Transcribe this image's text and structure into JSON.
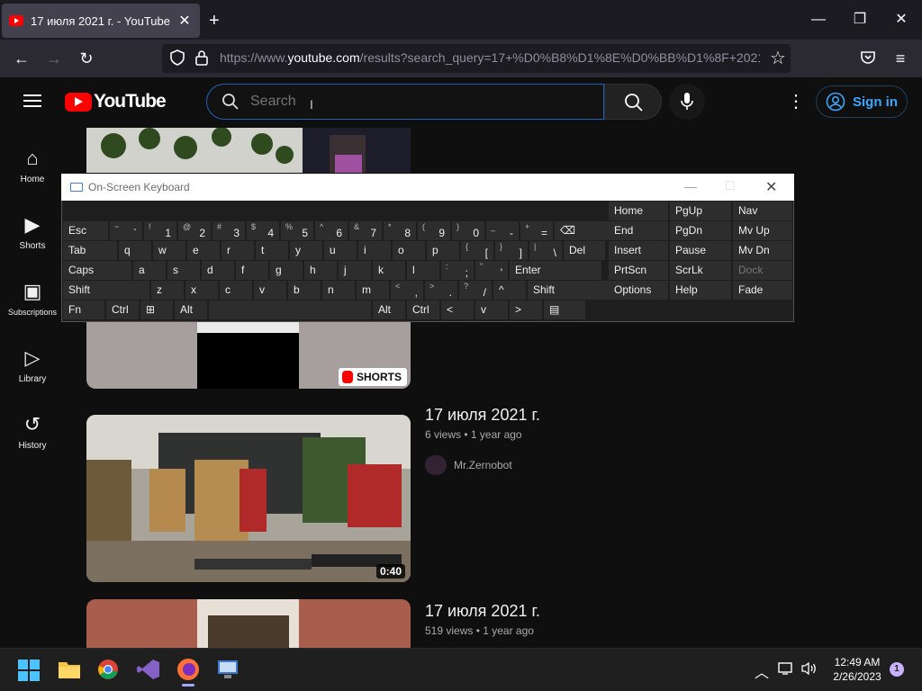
{
  "browser": {
    "tab_title": "17 июля 2021 г. - YouTube",
    "new_tab": "+",
    "url_prefix": "https://www.",
    "url_domain": "youtube.com",
    "url_rest": "/results?search_query=17+%D0%B8%D1%8E%D0%BB%D1%8F+2021+"
  },
  "youtube": {
    "logo_text": "YouTube",
    "search_placeholder": "Search",
    "signin": "Sign in",
    "sidebar": [
      {
        "label": "Home",
        "icon": "home-icon"
      },
      {
        "label": "Shorts",
        "icon": "shorts-icon"
      },
      {
        "label": "Subscriptions",
        "icon": "subscriptions-icon"
      },
      {
        "label": "Library",
        "icon": "library-icon"
      },
      {
        "label": "History",
        "icon": "history-icon"
      }
    ],
    "shorts_badge": "SHORTS",
    "videos": [
      {
        "title": "17 июля 2021 г.",
        "views": "6 views",
        "age": "1 year ago",
        "channel": "Mr.Zernobot",
        "duration": "0:40"
      },
      {
        "title": "17 июля 2021 г.",
        "views": "519 views",
        "age": "1 year ago"
      }
    ]
  },
  "osk": {
    "title": "On-Screen Keyboard",
    "rows": [
      [
        {
          "l": "Esc"
        },
        {
          "l": "`",
          "s": "~"
        },
        {
          "l": "1",
          "s": "!"
        },
        {
          "l": "2",
          "s": "@"
        },
        {
          "l": "3",
          "s": "#"
        },
        {
          "l": "4",
          "s": "$"
        },
        {
          "l": "5",
          "s": "%"
        },
        {
          "l": "6",
          "s": "^"
        },
        {
          "l": "7",
          "s": "&"
        },
        {
          "l": "8",
          "s": "*"
        },
        {
          "l": "9",
          "s": "("
        },
        {
          "l": "0",
          "s": ")"
        },
        {
          "l": "-",
          "s": "_"
        },
        {
          "l": "=",
          "s": "+"
        },
        {
          "l": "⌫"
        }
      ],
      [
        {
          "l": "Tab"
        },
        {
          "l": "q"
        },
        {
          "l": "w"
        },
        {
          "l": "e"
        },
        {
          "l": "r"
        },
        {
          "l": "t"
        },
        {
          "l": "y"
        },
        {
          "l": "u"
        },
        {
          "l": "i"
        },
        {
          "l": "o"
        },
        {
          "l": "p"
        },
        {
          "l": "[",
          "s": "{"
        },
        {
          "l": "]",
          "s": "}"
        },
        {
          "l": "\\",
          "s": "|"
        },
        {
          "l": "Del"
        }
      ],
      [
        {
          "l": "Caps"
        },
        {
          "l": "a"
        },
        {
          "l": "s"
        },
        {
          "l": "d"
        },
        {
          "l": "f"
        },
        {
          "l": "g"
        },
        {
          "l": "h"
        },
        {
          "l": "j"
        },
        {
          "l": "k"
        },
        {
          "l": "l"
        },
        {
          "l": ";",
          "s": ":"
        },
        {
          "l": "'",
          "s": "\""
        },
        {
          "l": "Enter"
        }
      ],
      [
        {
          "l": "Shift"
        },
        {
          "l": "z"
        },
        {
          "l": "x"
        },
        {
          "l": "c"
        },
        {
          "l": "v"
        },
        {
          "l": "b"
        },
        {
          "l": "n"
        },
        {
          "l": "m"
        },
        {
          "l": ",",
          "s": "<"
        },
        {
          "l": ".",
          "s": ">"
        },
        {
          "l": "/",
          "s": "?"
        },
        {
          "l": "^"
        },
        {
          "l": "Shift"
        }
      ],
      [
        {
          "l": "Fn"
        },
        {
          "l": "Ctrl"
        },
        {
          "l": "⊞"
        },
        {
          "l": "Alt"
        },
        {
          "l": ""
        },
        {
          "l": "Alt"
        },
        {
          "l": "Ctrl"
        },
        {
          "l": "<"
        },
        {
          "l": "v"
        },
        {
          "l": ">"
        },
        {
          "l": "▤"
        }
      ]
    ],
    "nav": [
      [
        "Home",
        "PgUp",
        "Nav"
      ],
      [
        "End",
        "PgDn",
        "Mv Up"
      ],
      [
        "Insert",
        "Pause",
        "Mv Dn"
      ],
      [
        "PrtScn",
        "ScrLk",
        "Dock"
      ],
      [
        "Options",
        "Help",
        "Fade"
      ]
    ]
  },
  "taskbar": {
    "time": "12:49 AM",
    "date": "2/26/2023",
    "notifications": "1"
  }
}
